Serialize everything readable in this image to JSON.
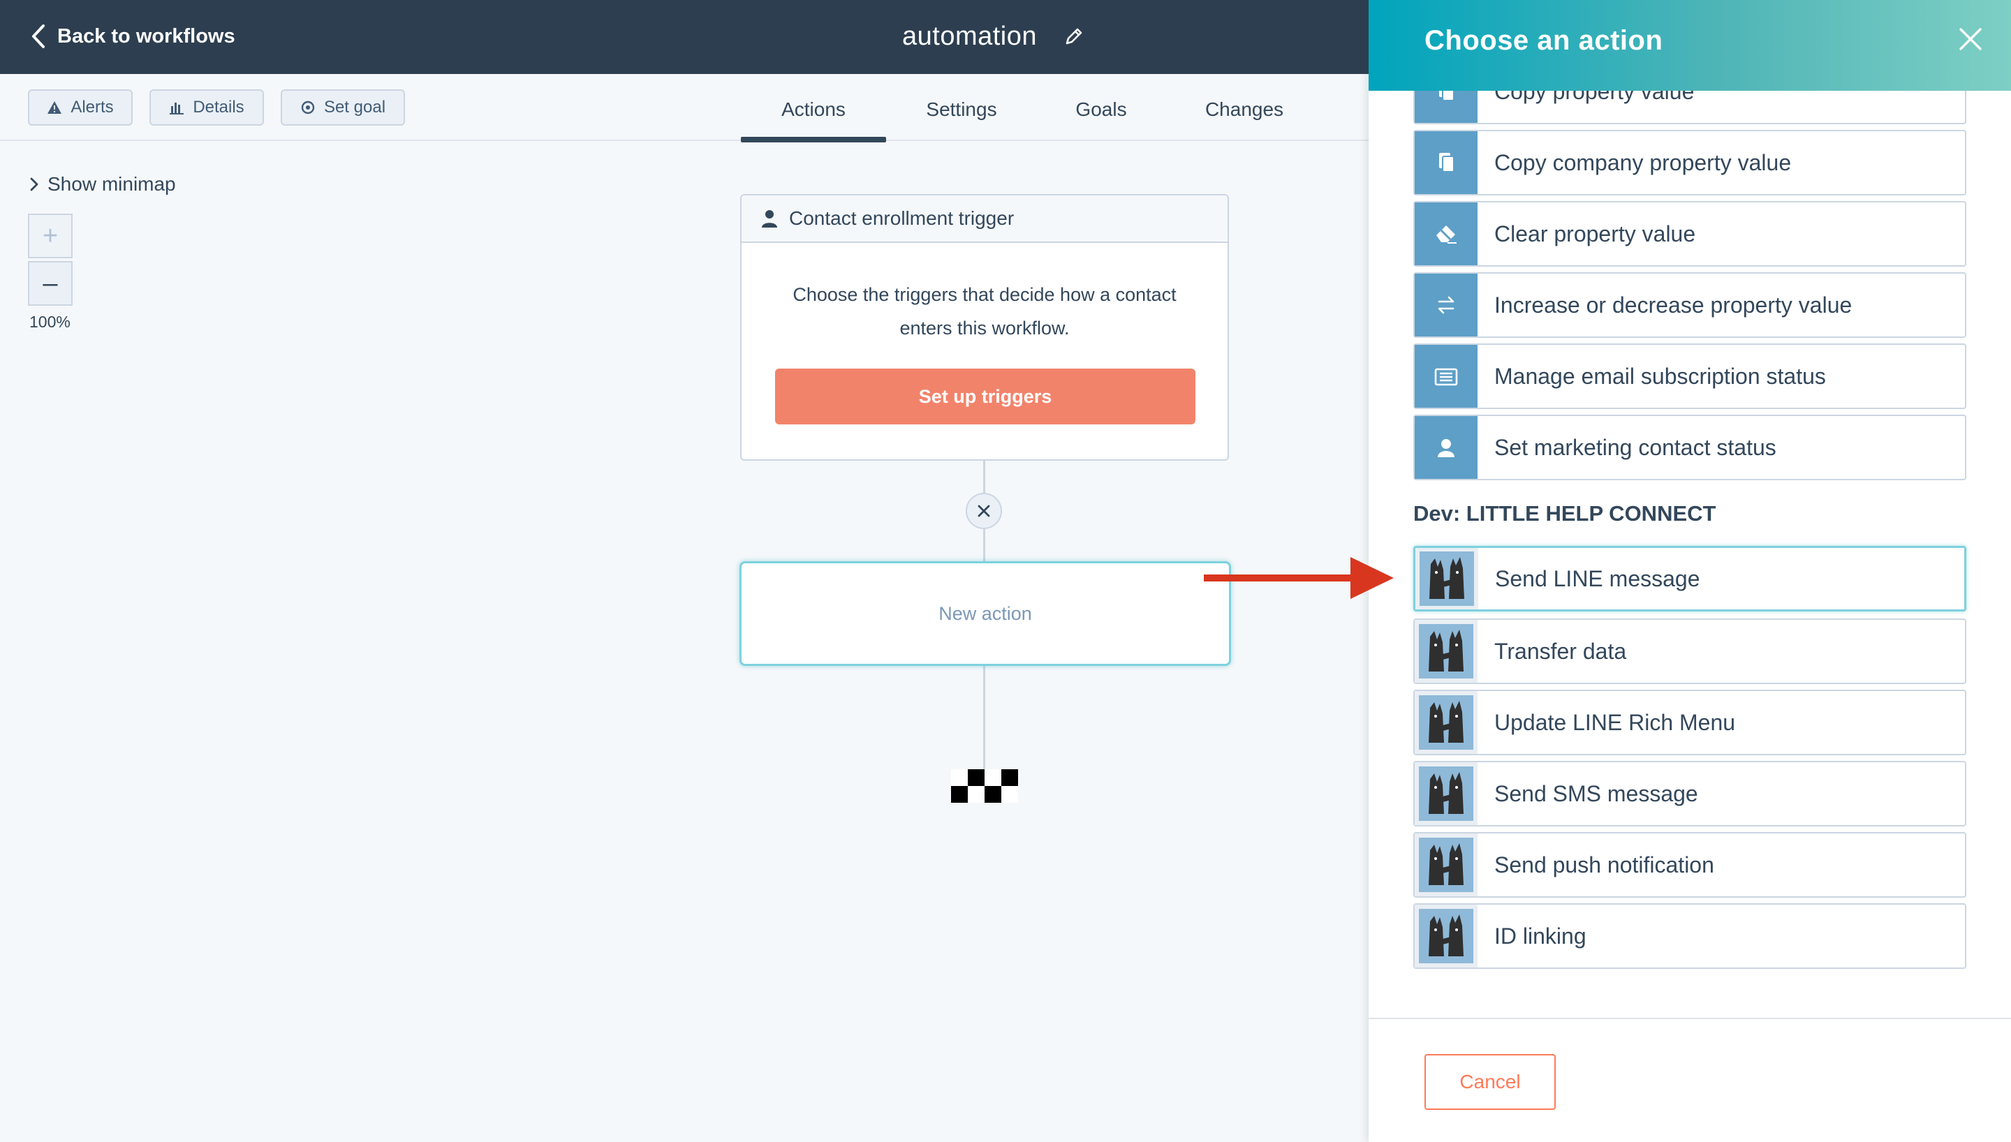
{
  "topbar": {
    "back_label": "Back to workflows",
    "workflow_name": "automation"
  },
  "toolbar": {
    "alerts_label": "Alerts",
    "details_label": "Details",
    "set_goal_label": "Set goal"
  },
  "tabs": [
    {
      "label": "Actions",
      "active": true
    },
    {
      "label": "Settings",
      "active": false
    },
    {
      "label": "Goals",
      "active": false
    },
    {
      "label": "Changes",
      "active": false
    }
  ],
  "canvas": {
    "minimap_label": "Show minimap",
    "zoom_in": "+",
    "zoom_out": "–",
    "zoom_level": "100%",
    "trigger": {
      "title": "Contact enrollment trigger",
      "description": "Choose the triggers that decide how a contact enters this workflow.",
      "button_label": "Set up triggers"
    },
    "new_action_label": "New action"
  },
  "panel": {
    "title": "Choose an action",
    "property_actions": [
      {
        "label": "Copy property value",
        "icon": "copy-icon"
      },
      {
        "label": "Copy company property value",
        "icon": "copy-icon"
      },
      {
        "label": "Clear property value",
        "icon": "eraser-icon"
      },
      {
        "label": "Increase or decrease property value",
        "icon": "swap-arrows-icon"
      },
      {
        "label": "Manage email subscription status",
        "icon": "newsletter-icon"
      },
      {
        "label": "Set marketing contact status",
        "icon": "contact-icon"
      }
    ],
    "app_section_title": "Dev: LITTLE HELP CONNECT",
    "app_actions": [
      {
        "label": "Send LINE message",
        "icon": "little-help-connect-logo-icon",
        "selected": true
      },
      {
        "label": "Transfer data",
        "icon": "little-help-connect-logo-icon"
      },
      {
        "label": "Update LINE Rich Menu",
        "icon": "little-help-connect-logo-icon"
      },
      {
        "label": "Send SMS message",
        "icon": "little-help-connect-logo-icon"
      },
      {
        "label": "Send push notification",
        "icon": "little-help-connect-logo-icon"
      },
      {
        "label": "ID linking",
        "icon": "little-help-connect-logo-icon"
      }
    ],
    "cancel_label": "Cancel"
  },
  "colors": {
    "topbar": "#2d3e50",
    "trigger_button": "#f2836b",
    "panel_header_start": "#00a4bd",
    "panel_header_end": "#7ecfc4",
    "action_icon": "#5d9fc7",
    "selected_border": "#7fd1de",
    "annotation_arrow": "#d9361f",
    "cancel": "#ff7a59"
  }
}
